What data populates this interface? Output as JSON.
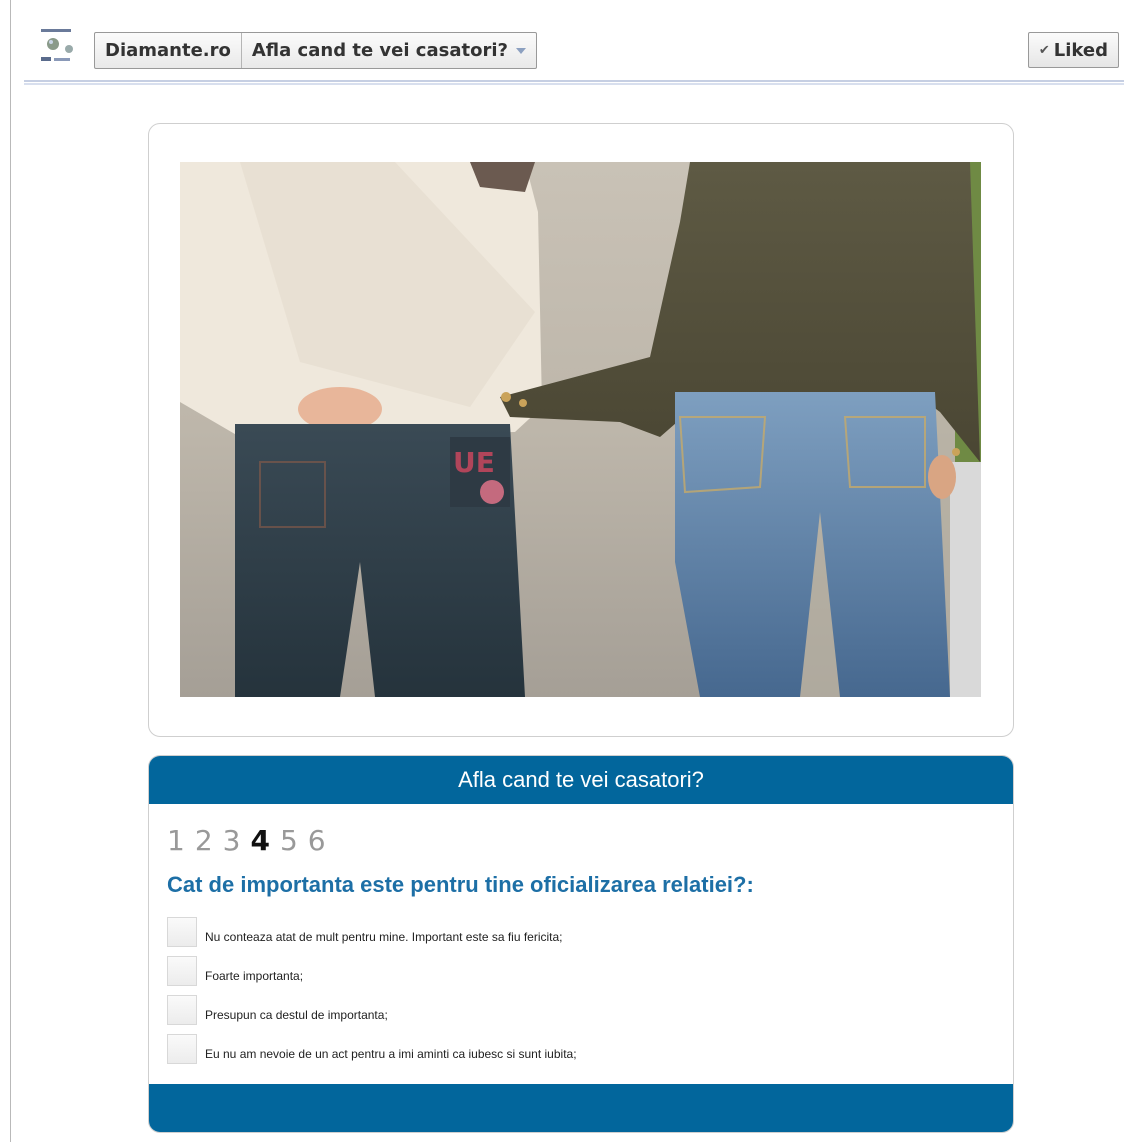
{
  "header": {
    "breadcrumb": [
      "Diamante.ro",
      "Afla cand te vei casatori?"
    ],
    "liked_label": "Liked"
  },
  "quiz": {
    "title": "Afla cand te vei casatori?",
    "steps": [
      "1",
      "2",
      "3",
      "4",
      "5",
      "6"
    ],
    "current_step": 4,
    "question": "Cat de importanta este pentru tine oficializarea relatiei?:",
    "options": [
      "Nu conteaza atat de mult pentru mine. Important este sa fiu fericita;",
      "Foarte importanta;",
      "Presupun ca destul de importanta;",
      "Eu nu am nevoie de un act pentru a imi aminti ca iubesc si sunt iubita;"
    ]
  },
  "colors": {
    "quiz_bar": "#02669c",
    "question_text": "#1d6fa6"
  }
}
